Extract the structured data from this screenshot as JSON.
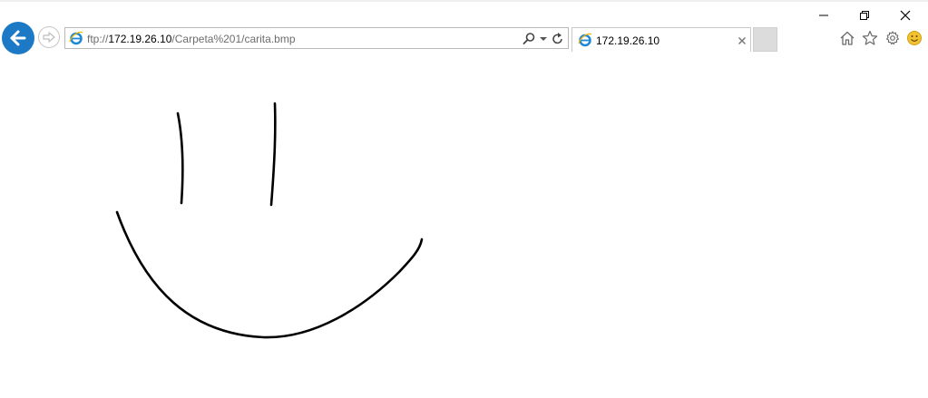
{
  "window": {
    "minimize_icon": "minimize-icon",
    "restore_icon": "restore-icon",
    "close_icon": "close-icon"
  },
  "nav": {
    "back_icon": "back-arrow-icon",
    "forward_icon": "forward-arrow-icon"
  },
  "address_bar": {
    "scheme": "ftp://",
    "host": "172.19.26.10",
    "path": "/Carpeta%201/carita.bmp",
    "site_icon": "ie-logo-icon",
    "search_icon": "search-icon",
    "dropdown_icon": "chevron-down-icon",
    "refresh_icon": "refresh-icon"
  },
  "tabs": [
    {
      "title": "172.19.26.10",
      "active": true,
      "close_icon": "close-icon"
    }
  ],
  "new_tab_icon": "new-tab-icon",
  "toolbar": {
    "home_icon": "home-icon",
    "favorites_icon": "star-icon",
    "settings_icon": "gear-icon",
    "feedback_icon": "smiley-icon"
  },
  "colors": {
    "back_button": "#1b79c6",
    "ie_logo": "#1e88d4",
    "feedback_smiley": "#f2c230",
    "drawing_stroke": "#000000"
  },
  "content": {
    "image_name": "carita.bmp",
    "image_description_icon": "smiley-drawing"
  }
}
